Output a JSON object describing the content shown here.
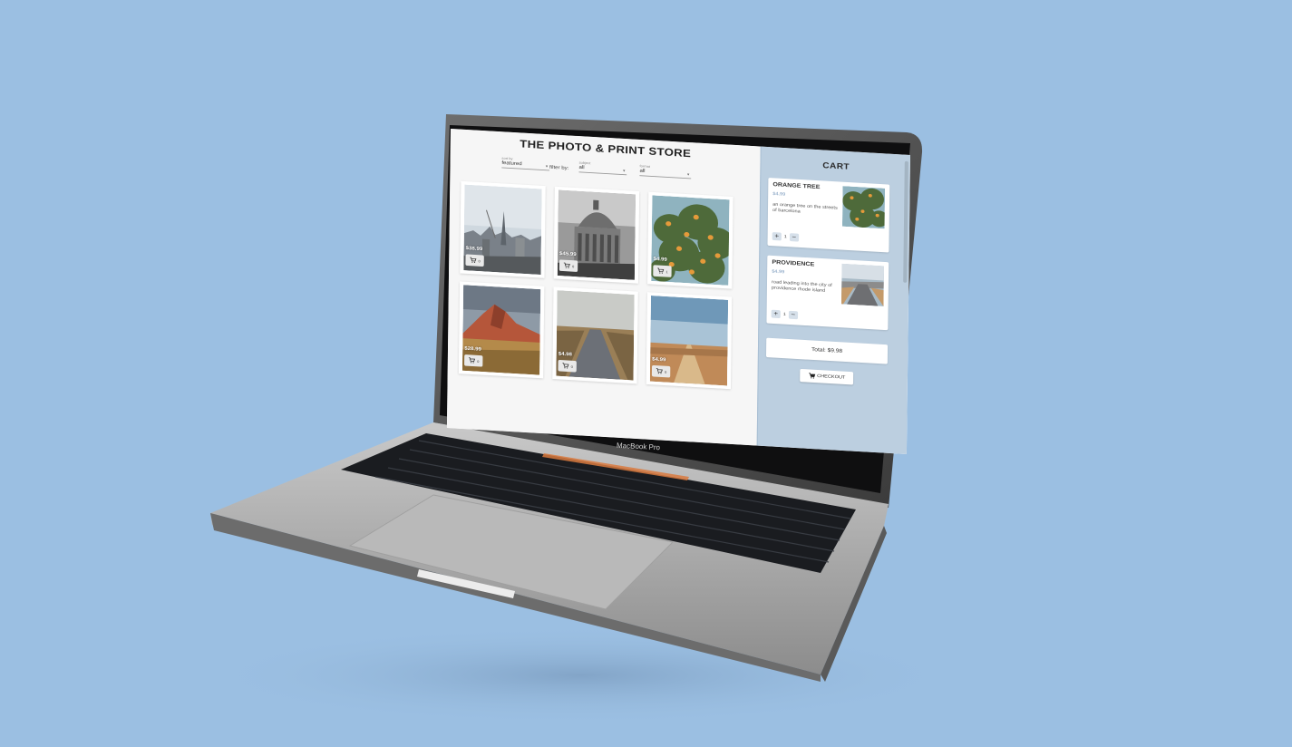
{
  "store": {
    "title": "THE PHOTO & PRINT STORE",
    "sort_caption": "sort by",
    "sort_value": "featured",
    "filter_by_label": "filter by:",
    "subject_caption": "subject",
    "subject_value": "all",
    "format_caption": "format",
    "format_value": "all",
    "products": [
      {
        "price": "$38.99",
        "qty": "0",
        "photo": "london-skyline"
      },
      {
        "price": "$45.99",
        "qty": "0",
        "photo": "domed-building"
      },
      {
        "price": "$4.99",
        "qty": "1",
        "photo": "orange-tree"
      },
      {
        "price": "$28.99",
        "qty": "0",
        "photo": "red-mountain"
      },
      {
        "price": "$4.98",
        "qty": "0",
        "photo": "boardwalk"
      },
      {
        "price": "$4.99",
        "qty": "0",
        "photo": "desert-road"
      }
    ]
  },
  "cart": {
    "title": "CART",
    "items": [
      {
        "name": "ORANGE TREE",
        "price": "$4.99",
        "description": "an orange tree on the streets of barcelona",
        "qty": "1"
      },
      {
        "name": "PROVIDENCE",
        "price": "$4.99",
        "description": "road leading into the city of providence rhode island",
        "qty": "1"
      }
    ],
    "total": "Total: $9.98",
    "checkout_label": "CHECKOUT"
  },
  "device": {
    "brand_label": "MacBook Pro"
  },
  "colors": {
    "background": "#9bbfe2",
    "cart_panel": "#bccfe0",
    "price_accent": "#9fb6cf"
  }
}
